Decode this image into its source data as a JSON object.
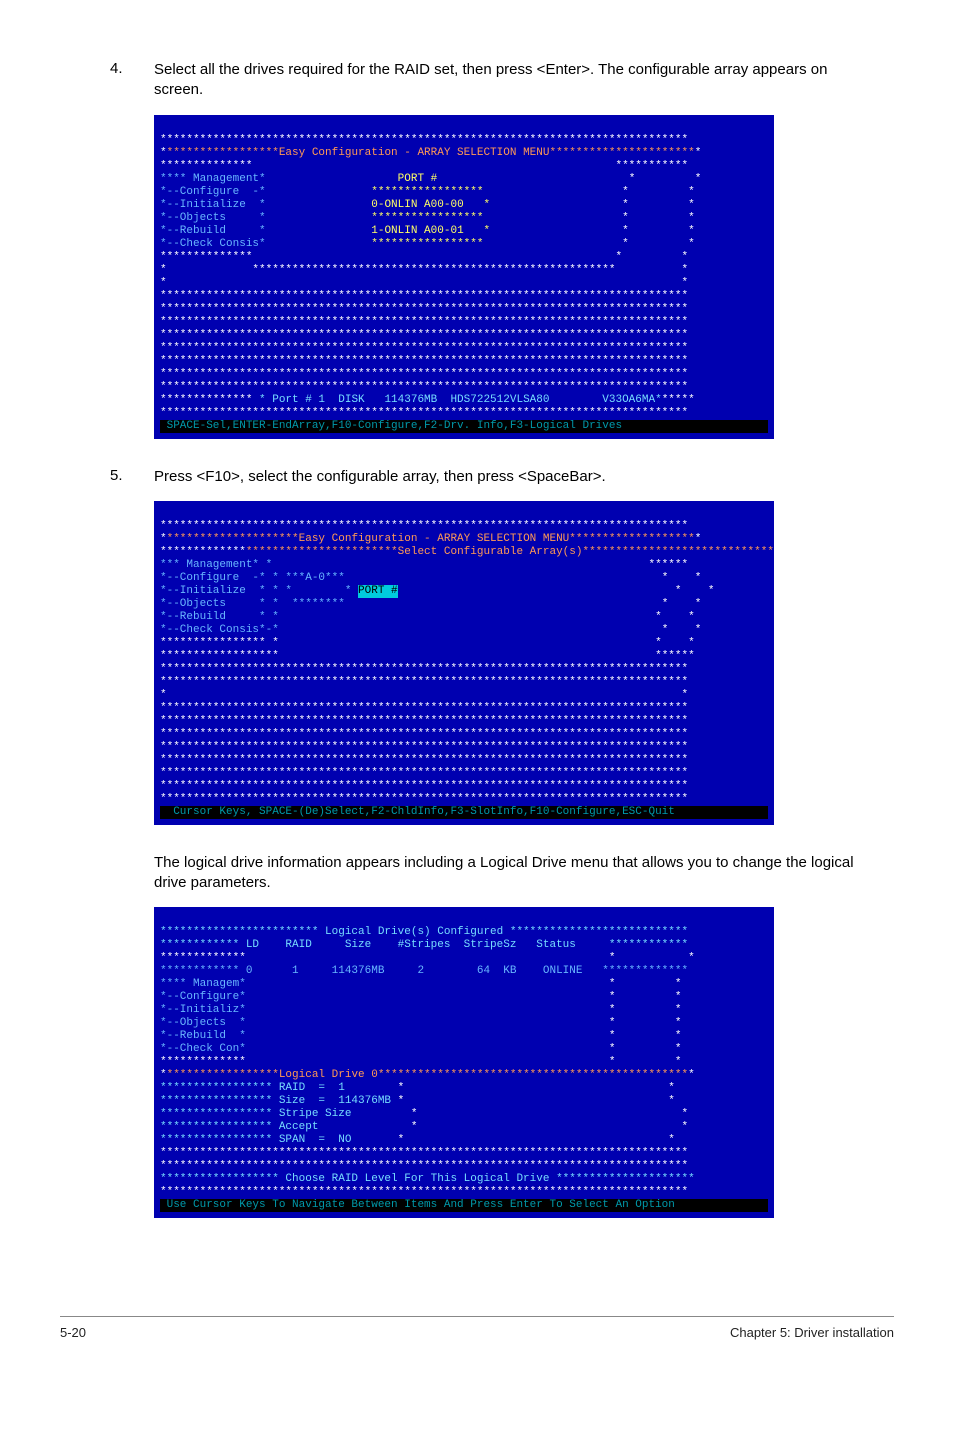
{
  "steps": {
    "s4": {
      "num": "4.",
      "text": "Select all the drives required for the RAID set, then press <Enter>. The configurable array appears on screen."
    },
    "s5": {
      "num": "5.",
      "text": "Press <F10>, select the configurable array, then press <SpaceBar>."
    },
    "midtext": "The logical drive information appears including a Logical Drive menu that allows you to change the logical drive parameters."
  },
  "screen1": {
    "titlebar": "*****************Easy Configuration - ARRAY SELECTION MENU**********************",
    "menu": {
      "heading": "**** Management*",
      "items": [
        "*--Configure  -*",
        "*--Initialize  *",
        "*--Objects     *",
        "*--Rebuild     *",
        "*--Check Consis*"
      ]
    },
    "port_heading": "PORT #",
    "port_lines": [
      "*****************",
      "0-ONLIN A00-00   *",
      "*****************",
      "1-ONLIN A00-01   *",
      "*****************"
    ],
    "detail": " * Port # 1  DISK   114376MB  HDS722512VLSA80        V33OA6MA*",
    "help": " SPACE-Sel,ENTER-EndArray,F10-Configure,F2-Drv. Info,F3-Logical Drives "
  },
  "screen2": {
    "titlebar1": "********************Easy Configuration - ARRAY SELECTION MENU*******************",
    "titlebar2": "***********************Select Configurable Array(s)*****************************",
    "menu_heading": "*** Management* *",
    "menu_items": [
      "*--Configure  -* * ***A-0***",
      "*--Initialize  * * *        *",
      "*--Objects     * *  ********",
      "*--Rebuild     * *",
      "*--Check Consis*-*"
    ],
    "portbox": "PORT #",
    "help": "  Cursor Keys, SPACE-(De)Select,F2-ChldInfo,F3-SlotInfo,F10-Configure,ESC-Quit "
  },
  "screen3": {
    "colbar": "************************ Logical Drive(s) Configured ***************************",
    "hdr": "************ LD    RAID     Size    #Stripes  StripeSz   Status     ************",
    "row": "************ 0      1     114376MB     2        64  KB    ONLINE   *************",
    "menu_heading": "**** Managem*",
    "menu_items": [
      "*--Configure*",
      "*--Initializ*",
      "*--Objects  *",
      "*--Rebuild  *",
      "*--Check Con*"
    ],
    "drive0_hdr": "*****************Logical Drive 0***********************************************",
    "drive0_items": [
      "***************** RAID  =  1",
      "***************** Size  =  114376MB",
      "***************** Stripe Size",
      "***************** Accept",
      "***************** SPAN  =  NO"
    ],
    "choose": "****************** Choose RAID Level For This Logical Drive *********************",
    "help": " Use Cursor Keys To Navigate Between Items And Press Enter To Select An Option "
  },
  "footer": {
    "left": "5-20",
    "right": "Chapter 5: Driver installation"
  }
}
